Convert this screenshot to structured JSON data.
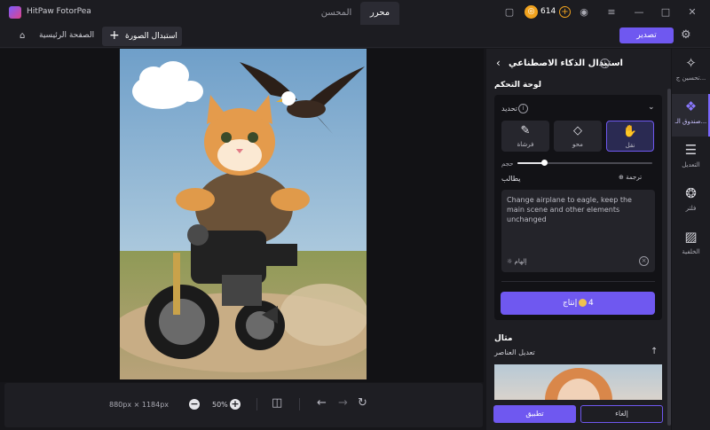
{
  "titlebar": {
    "app_name": "HitPaw FotorPea",
    "tabs": [
      {
        "label": "محرر",
        "active": true
      },
      {
        "label": "المحسن",
        "active": false
      }
    ],
    "coins": "614"
  },
  "tabbar": {
    "home_label": "الصفحة الرئيسية",
    "active_tab_label": "استبدال الصورة",
    "export_label": "تصدير"
  },
  "bottombar": {
    "image_size": "880px × 1184px",
    "zoom": "50%"
  },
  "panel": {
    "title": "استبدال الذكاء الاصطناعي",
    "control_label": "لوحة التحكم",
    "selection_label": "تحديد",
    "tools": [
      {
        "label": "نقل",
        "icon": "hand-icon",
        "active": true
      },
      {
        "label": "محو",
        "icon": "eraser-icon",
        "active": false
      },
      {
        "label": "فرشاة",
        "icon": "brush-icon",
        "active": false
      }
    ],
    "size_label": "حجم",
    "size_value": 0.2,
    "prompt_label": "يطالب",
    "translate_label": "ترجمة",
    "prompt_text": "Change airplane to eagle, keep the main scene and other elements unchanged",
    "inspire_label": "إلهام",
    "generate_label": "إنتاج",
    "generate_cost": "4",
    "example_label": "مثال",
    "example_sub": "تعديل العناصر",
    "cancel_label": "إلغاء",
    "apply_label": "تطبيق"
  },
  "sidebar": {
    "items": [
      {
        "label": "تحسين ج...",
        "icon": "enhance-icon",
        "active": false
      },
      {
        "label": "صندوق الـ...",
        "icon": "toolbox-icon",
        "active": true
      },
      {
        "label": "التعديل",
        "icon": "adjust-icon",
        "active": false
      },
      {
        "label": "فلتر",
        "icon": "filter-icon",
        "active": false
      },
      {
        "label": "الخلفية",
        "icon": "background-icon",
        "active": false
      }
    ]
  },
  "colors": {
    "accent": "#6f58f0",
    "coin": "#f0a21e",
    "background": "#16161a",
    "panel": "#1e1e23"
  }
}
